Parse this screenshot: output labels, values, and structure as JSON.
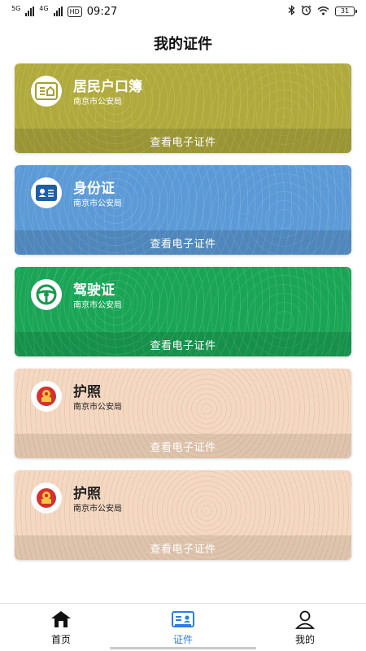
{
  "status_bar": {
    "network_1": "5G",
    "network_2": "4G",
    "hd": "HD",
    "time": "09:27",
    "battery": "31",
    "icons": [
      "bluetooth-icon",
      "alarm-icon",
      "wifi-icon",
      "battery-icon"
    ]
  },
  "page": {
    "title": "我的证件"
  },
  "cards": [
    {
      "title": "居民户口簿",
      "issuer": "南京市公安局",
      "action": "查看电子证件",
      "color": "#b0aa3c",
      "icon": "household-register-icon"
    },
    {
      "title": "身份证",
      "issuer": "南京市公安局",
      "action": "查看电子证件",
      "color": "#5b9ad6",
      "icon": "id-card-icon"
    },
    {
      "title": "驾驶证",
      "issuer": "南京市公安局",
      "action": "查看电子证件",
      "color": "#1aa556",
      "icon": "steering-wheel-icon"
    },
    {
      "title": "护照",
      "issuer": "南京市公安局",
      "action": "查看电子证件",
      "color": "#f3d9c2",
      "icon": "national-emblem-icon"
    },
    {
      "title": "护照",
      "issuer": "南京市公安局",
      "action": "查看电子证件",
      "color": "#f3d9c2",
      "icon": "national-emblem-icon"
    }
  ],
  "nav": {
    "items": [
      {
        "label": "首页",
        "icon": "home-icon",
        "active": false
      },
      {
        "label": "证件",
        "icon": "certificates-icon",
        "active": true
      },
      {
        "label": "我的",
        "icon": "user-icon",
        "active": false
      }
    ],
    "active_color": "#2b7de9"
  }
}
